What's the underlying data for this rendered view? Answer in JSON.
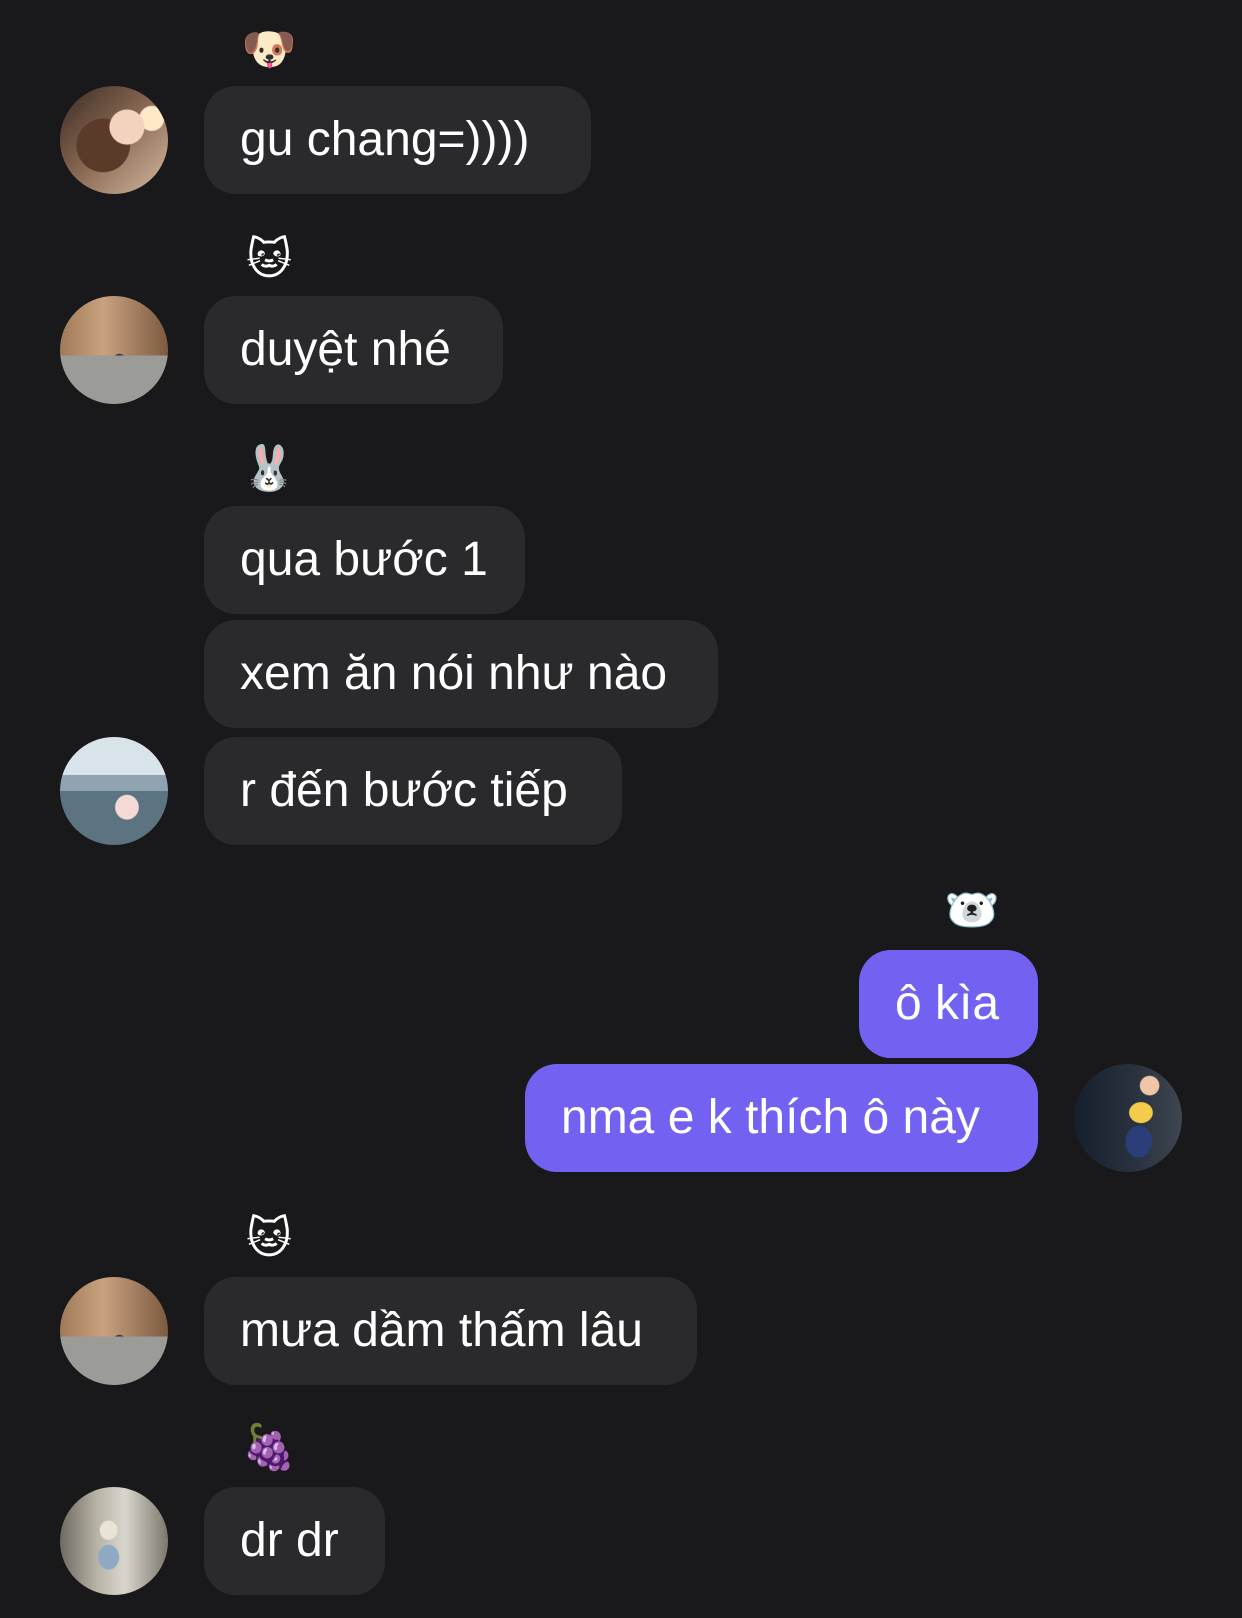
{
  "messages": [
    {
      "reaction": "🐶",
      "text": "gu chang=))))"
    },
    {
      "reaction": "🐱",
      "text": "duyệt nhé"
    },
    {
      "reaction": "🐰",
      "text": "qua bước 1"
    },
    {
      "text": "xem ăn nói như nào"
    },
    {
      "text": "r đến bước tiếp"
    },
    {
      "reaction": "🐻‍❄️",
      "text": "ô kìa"
    },
    {
      "text": "nma e k thích ô này"
    },
    {
      "reaction": "🐱",
      "text": "mưa dầm thấm lâu"
    },
    {
      "reaction": "🍇",
      "text": "dr dr"
    }
  ],
  "colors": {
    "background": "#19191b",
    "incoming_bubble": "#2a2a2d",
    "outgoing_bubble": "#7361f2",
    "text": "#ffffff"
  }
}
